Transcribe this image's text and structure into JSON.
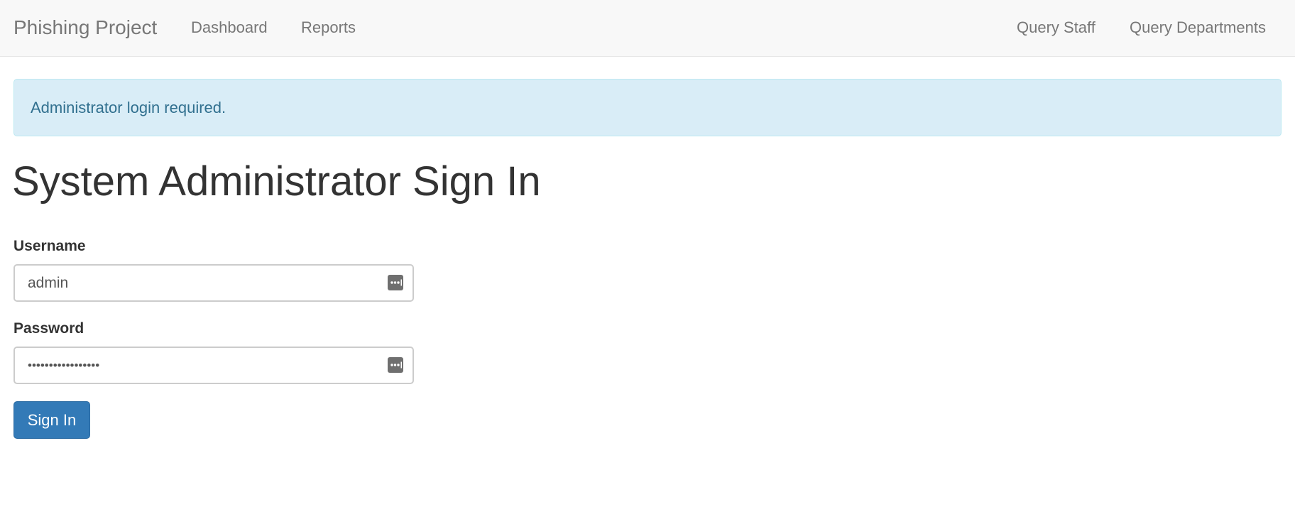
{
  "navbar": {
    "brand": "Phishing Project",
    "left_links": [
      "Dashboard",
      "Reports"
    ],
    "right_links": [
      "Query Staff",
      "Query Departments"
    ]
  },
  "alert": {
    "message": "Administrator login required."
  },
  "page": {
    "title": "System Administrator Sign In"
  },
  "form": {
    "username_label": "Username",
    "username_value": "admin",
    "password_label": "Password",
    "password_value": "•••••••••••••••••",
    "submit_label": "Sign In"
  },
  "icons": {
    "password_manager": "password-manager-icon"
  },
  "colors": {
    "navbar_bg": "#f8f8f8",
    "alert_bg": "#d9edf7",
    "alert_text": "#31708f",
    "primary_button": "#337ab7"
  }
}
